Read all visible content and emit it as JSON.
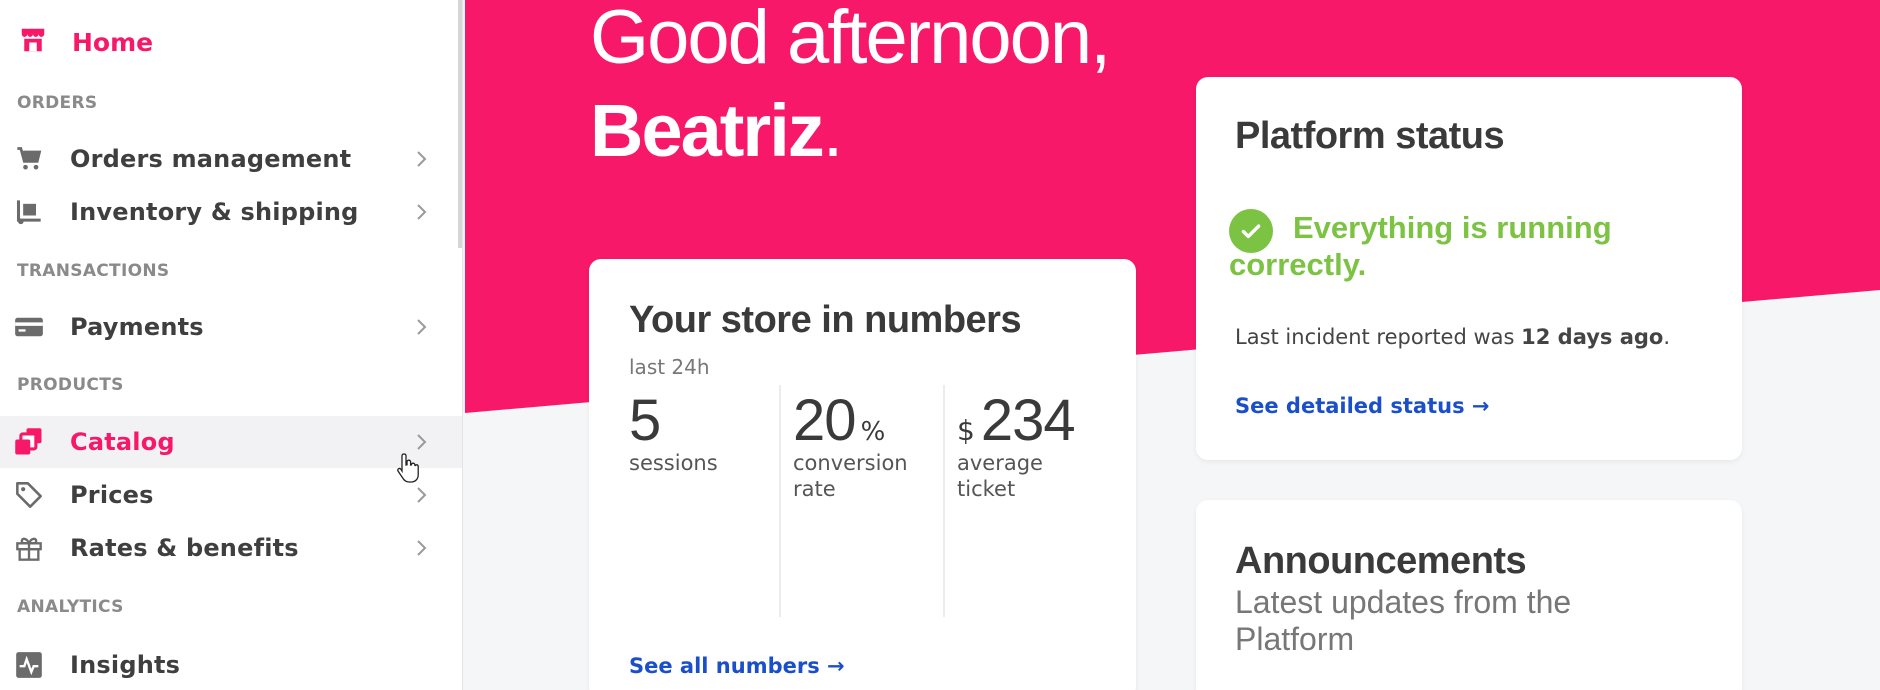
{
  "colors": {
    "brand": "#f7186a",
    "success": "#7cc243",
    "link": "#1a4fc9"
  },
  "sidebar": {
    "home": {
      "label": "Home",
      "icon": "store-icon"
    },
    "sections": [
      "ORDERS",
      "TRANSACTIONS",
      "PRODUCTS",
      "ANALYTICS"
    ],
    "items": [
      {
        "label": "Orders management",
        "icon": "cart-icon"
      },
      {
        "label": "Inventory & shipping",
        "icon": "hand-truck-icon"
      },
      {
        "label": "Payments",
        "icon": "credit-card-icon"
      },
      {
        "label": "Catalog",
        "icon": "catalog-icon",
        "active": true
      },
      {
        "label": "Prices",
        "icon": "price-tag-icon"
      },
      {
        "label": "Rates & benefits",
        "icon": "gift-icon"
      },
      {
        "label": "Insights",
        "icon": "chart-pulse-icon"
      }
    ]
  },
  "hero": {
    "greeting": "Good afternoon,",
    "name": "Beatriz",
    "punct": "."
  },
  "store": {
    "title": "Your store in numbers",
    "subtitle": "last 24h",
    "stats": [
      {
        "value": "5",
        "unit": "",
        "prefix": "",
        "desc": "sessions"
      },
      {
        "value": "20",
        "unit": "%",
        "prefix": "",
        "desc": "conversion rate"
      },
      {
        "value": "234",
        "unit": "",
        "prefix": "$",
        "desc": "average ticket"
      }
    ],
    "link": "See all numbers →"
  },
  "status": {
    "title": "Platform status",
    "message": "Everything is running correctly.",
    "incident_prefix": "Last incident reported was ",
    "incident_bold": "12 days ago",
    "incident_suffix": ".",
    "link": "See detailed status →"
  },
  "announcements": {
    "title": "Announcements",
    "subtitle": "Latest updates from the Platform"
  }
}
